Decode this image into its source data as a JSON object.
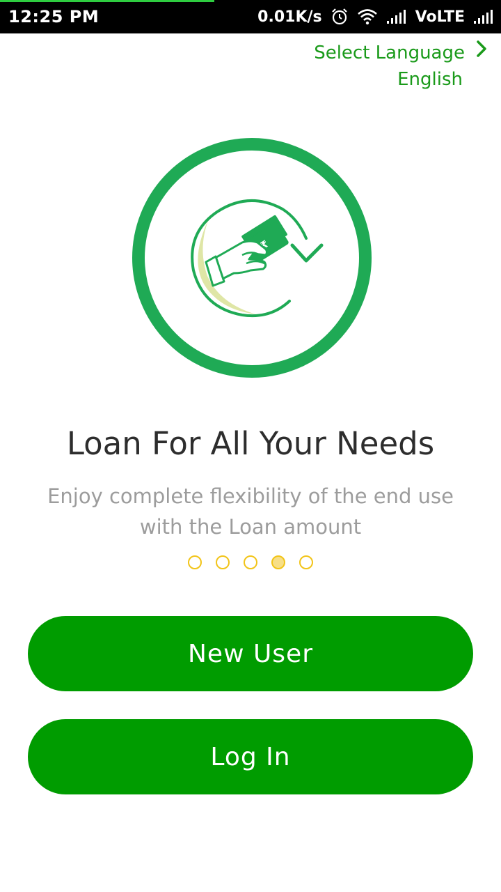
{
  "status_bar": {
    "time": "12:25 PM",
    "network_speed": "0.01K/s",
    "carrier_label": "VoLTE",
    "icons": [
      "alarm-icon",
      "wifi-icon",
      "signal-icon",
      "signal-icon"
    ]
  },
  "language": {
    "label": "Select Language",
    "value": "English",
    "icon": "chevron-right-icon"
  },
  "onboarding": {
    "illustration_icon": "hand-money-icon",
    "title": "Loan For All Your Needs",
    "subtitle": "Enjoy complete flexibility of the end use with the Loan amount",
    "page_count": 5,
    "active_page": 4
  },
  "actions": {
    "new_user_label": "New User",
    "login_label": "Log In"
  },
  "colors": {
    "primary": "#009c00",
    "accent_green": "#1faa55",
    "dot_yellow": "#f2c418",
    "text_dark": "#2d2d2d",
    "text_muted": "#9c9c9c"
  }
}
